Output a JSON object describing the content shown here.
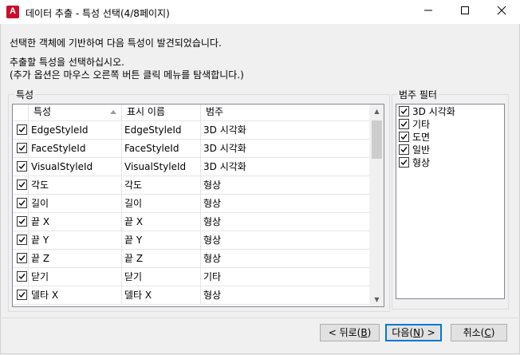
{
  "window": {
    "title": "데이터 추출 - 특성 선택(4/8페이지)",
    "icon_label": "A",
    "minimize_glyph": "—",
    "maximize_glyph": "☐",
    "close_glyph": "✕"
  },
  "messages": {
    "line1": "선택한 객체에 기반하여 다음 특성이 발견되었습니다.",
    "line2": "추출할 특성을 선택하십시오.",
    "line3": "(추가 옵션은 마우스 오른쪽 버튼 클릭 메뉴를 탐색합니다.)"
  },
  "properties_group": {
    "label": "특성",
    "columns": [
      "특성",
      "표시 이름",
      "범주"
    ],
    "rows": [
      {
        "checked": true,
        "property": "EdgeStyleId",
        "display": "EdgeStyleId",
        "category": "3D 시각화"
      },
      {
        "checked": true,
        "property": "FaceStyleId",
        "display": "FaceStyleId",
        "category": "3D 시각화"
      },
      {
        "checked": true,
        "property": "VisualStyleId",
        "display": "VisualStyleId",
        "category": "3D 시각화"
      },
      {
        "checked": true,
        "property": "각도",
        "display": "각도",
        "category": "형상"
      },
      {
        "checked": true,
        "property": "길이",
        "display": "길이",
        "category": "형상"
      },
      {
        "checked": true,
        "property": "끝 X",
        "display": "끝 X",
        "category": "형상"
      },
      {
        "checked": true,
        "property": "끝 Y",
        "display": "끝 Y",
        "category": "형상"
      },
      {
        "checked": true,
        "property": "끝 Z",
        "display": "끝 Z",
        "category": "형상"
      },
      {
        "checked": true,
        "property": "닫기",
        "display": "닫기",
        "category": "기타"
      },
      {
        "checked": true,
        "property": "델타 X",
        "display": "델타 X",
        "category": "형상"
      }
    ]
  },
  "filter_group": {
    "label": "범주 필터",
    "items": [
      {
        "checked": true,
        "label": "3D 시각화"
      },
      {
        "checked": true,
        "label": "기타"
      },
      {
        "checked": true,
        "label": "도면"
      },
      {
        "checked": true,
        "label": "일반"
      },
      {
        "checked": true,
        "label": "형상"
      }
    ]
  },
  "buttons": {
    "back": {
      "label": "< 뒤로(",
      "key": "B",
      "suffix": ")"
    },
    "next": {
      "label": "다음(",
      "key": "N",
      "suffix": ") >"
    },
    "cancel": {
      "label": "취소(",
      "key": "C",
      "suffix": ")"
    }
  },
  "colors": {
    "accent": "#0078d7",
    "app_icon": "#c8102e"
  }
}
